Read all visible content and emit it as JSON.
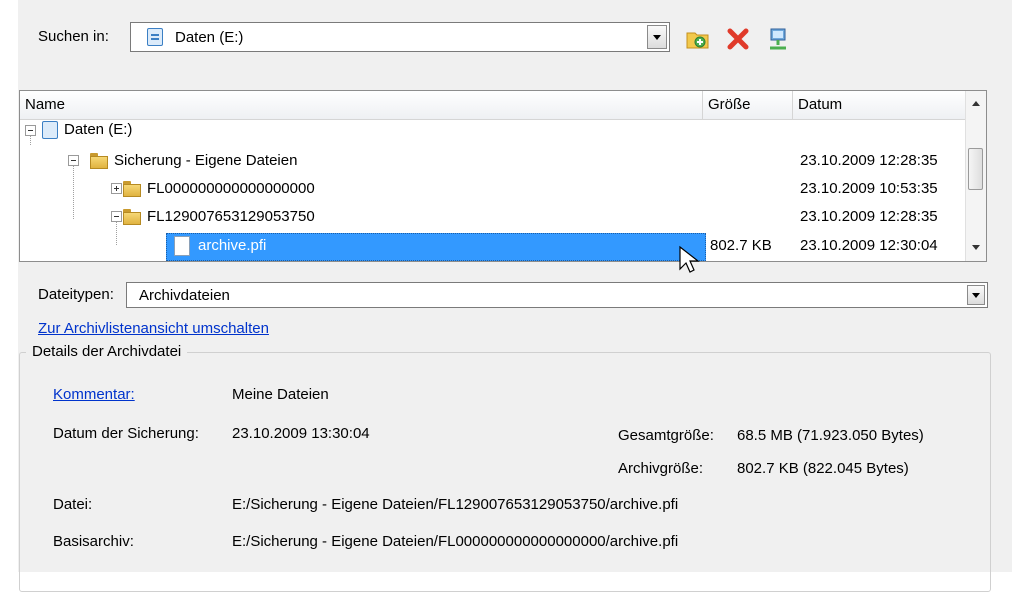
{
  "search": {
    "label": "Suchen in:",
    "value": "Daten (E:)"
  },
  "toolbar": {
    "new_folder_icon": "new-folder-icon",
    "delete_icon": "delete-icon",
    "network_icon": "network-icon"
  },
  "list": {
    "columns": {
      "name": "Name",
      "size": "Größe",
      "date": "Datum"
    },
    "rows": [
      {
        "name": "Daten (E:)",
        "size": "",
        "date": ""
      },
      {
        "name": "Sicherung - Eigene Dateien",
        "size": "",
        "date": "23.10.2009 12:28:35"
      },
      {
        "name": "FL000000000000000000",
        "size": "",
        "date": "23.10.2009 10:53:35"
      },
      {
        "name": "FL129007653129053750",
        "size": "",
        "date": "23.10.2009 12:28:35"
      },
      {
        "name": "archive.pfi",
        "size": "802.7 KB",
        "date": "23.10.2009 12:30:04"
      }
    ]
  },
  "filetypes": {
    "label": "Dateitypen:",
    "value": "Archivdateien"
  },
  "toggle_link": "Zur Archivlistenansicht umschalten",
  "details": {
    "title": "Details der Archivdatei",
    "comment_label": "Kommentar:",
    "comment_value": "Meine Dateien",
    "date_label": "Datum der Sicherung:",
    "date_value": "23.10.2009 13:30:04",
    "total_label": "Gesamtgröße:",
    "total_value": "68.5 MB (71.923.050 Bytes)",
    "archive_label": "Archivgröße:",
    "archive_value": "802.7 KB (822.045 Bytes)",
    "file_label": "Datei:",
    "file_value": "E:/Sicherung - Eigene Dateien/FL129007653129053750/archive.pfi",
    "base_label": "Basisarchiv:",
    "base_value": "E:/Sicherung - Eigene Dateien/FL000000000000000000/archive.pfi"
  }
}
